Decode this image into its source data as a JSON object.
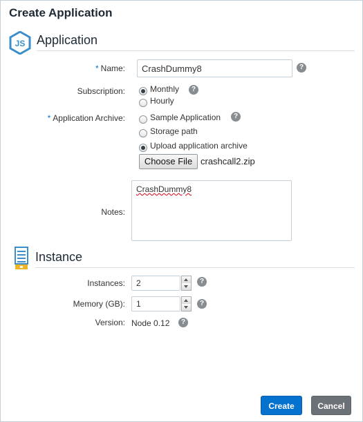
{
  "dialog": {
    "title": "Create Application"
  },
  "application_section": {
    "title": "Application",
    "icon": "nodejs-icon",
    "name": {
      "label": "Name:",
      "value": "CrashDummy8",
      "required": true
    },
    "subscription": {
      "label": "Subscription:",
      "options": [
        {
          "label": "Monthly",
          "checked": true
        },
        {
          "label": "Hourly",
          "checked": false
        }
      ]
    },
    "archive": {
      "label": "Application Archive:",
      "required": true,
      "options": [
        {
          "label": "Sample Application",
          "checked": false
        },
        {
          "label": "Storage path",
          "checked": false
        },
        {
          "label": "Upload application archive",
          "checked": true
        }
      ],
      "choose_file_label": "Choose File",
      "file_name": "crashcall2.zip"
    },
    "notes": {
      "label": "Notes:",
      "value": "CrashDummy8"
    }
  },
  "instance_section": {
    "title": "Instance",
    "icon": "server-instance-icon",
    "instances": {
      "label": "Instances:",
      "value": "2"
    },
    "memory": {
      "label": "Memory (GB):",
      "value": "1"
    },
    "version": {
      "label": "Version:",
      "value": "Node 0.12"
    }
  },
  "help_glyph": "?",
  "required_marker": "*",
  "footer": {
    "create_label": "Create",
    "cancel_label": "Cancel"
  },
  "colors": {
    "primary": "#0572ce",
    "secondary_button": "#6b7177",
    "help_icon": "#888d92",
    "nodejs_icon": "#3b8ec9",
    "instance_icon": "#3b8ec9"
  }
}
